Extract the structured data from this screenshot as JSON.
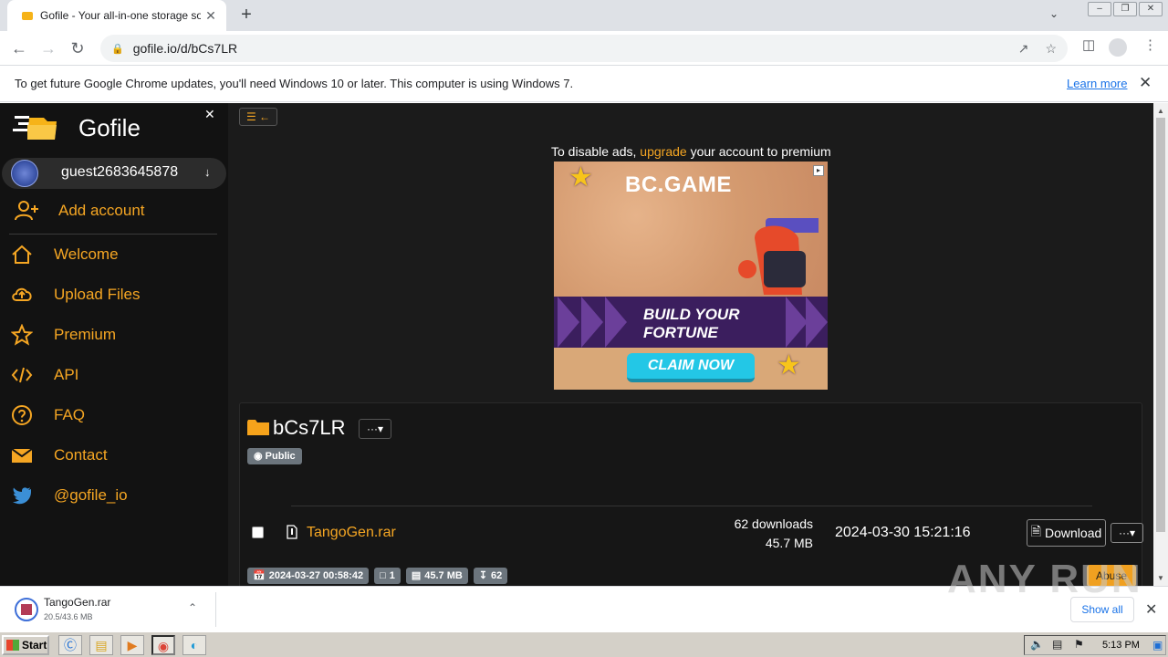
{
  "browser": {
    "tab_title": "Gofile - Your all-in-one storage solution",
    "url": "gofile.io/d/bCs7LR",
    "new_tab": "+",
    "close_tab": "✕"
  },
  "infobar": {
    "message": "To get future Google Chrome updates, you'll need Windows 10 or later. This computer is using Windows 7.",
    "learn_more": "Learn more"
  },
  "sidebar": {
    "brand": "Gofile",
    "account_name": "guest2683645878",
    "add_account": "Add account",
    "items": [
      {
        "label": "Welcome",
        "icon": "home-icon"
      },
      {
        "label": "Upload Files",
        "icon": "cloud-upload-icon"
      },
      {
        "label": "Premium",
        "icon": "star-icon"
      },
      {
        "label": "API",
        "icon": "code-icon"
      },
      {
        "label": "FAQ",
        "icon": "question-icon"
      },
      {
        "label": "Contact",
        "icon": "envelope-icon"
      },
      {
        "label": "@gofile_io",
        "icon": "twitter-icon"
      }
    ]
  },
  "ad": {
    "prefix": "To disable ads, ",
    "link": "upgrade",
    "suffix": " your account to premium",
    "brand": "BC.GAME",
    "headline_1": "BUILD YOUR",
    "headline_2": "FORTUNE",
    "cta": "CLAIM NOW"
  },
  "folder": {
    "name": "bCs7LR",
    "visibility": "Public",
    "menu": "···▾",
    "files": [
      {
        "name": "TangoGen.rar",
        "downloads": "62 downloads",
        "size": "45.7 MB",
        "date": "2024-03-30 15:21:16",
        "download_label": "Download",
        "menu": "···▾"
      }
    ],
    "stats": {
      "created": "2024-03-27 00:58:42",
      "file_count": "1",
      "total_size": "45.7 MB",
      "downloads": "62"
    },
    "abuse": "Abuse"
  },
  "download_shelf": {
    "file_name": "TangoGen.rar",
    "progress": "20.5/43.6 MB",
    "show_all": "Show all"
  },
  "taskbar": {
    "start": "Start",
    "clock": "5:13 PM"
  },
  "watermark": "ANY RUN",
  "colors": {
    "accent": "#f5a623",
    "page_bg": "#1b1b1b",
    "sidebar_bg": "#121212",
    "badge": "#6c757d"
  }
}
